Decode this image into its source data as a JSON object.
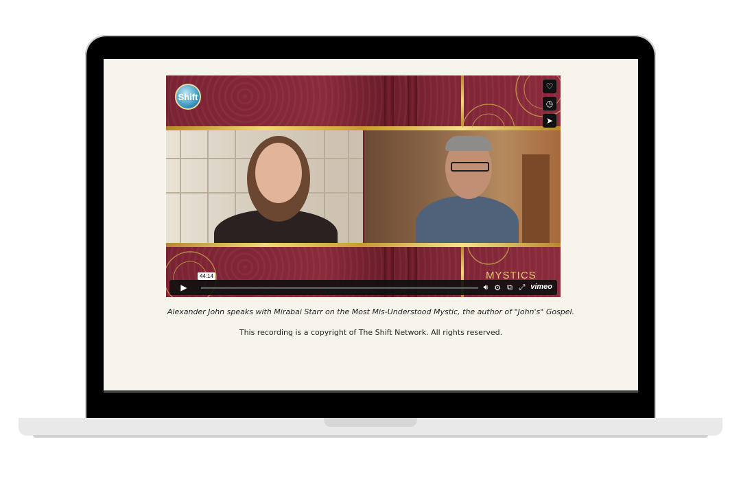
{
  "player": {
    "logo_text": "Shift",
    "banner_text": "MYSTICS",
    "time_tooltip": "44:14",
    "brand": "vimeo",
    "progress": 0.0,
    "icons": {
      "like": "heart-icon",
      "watch_later": "clock-icon",
      "share": "send-icon",
      "play": "play-icon",
      "volume": "volume-icon",
      "settings": "gear-icon",
      "pip": "picture-in-picture-icon",
      "fullscreen": "fullscreen-icon"
    }
  },
  "content": {
    "caption": "Alexander John speaks with Mirabai Starr on the Most Mis-Understood Mystic, the author of \"John's\" Gospel.",
    "copyright": "This recording is a copyright of The Shift Network. All rights reserved."
  },
  "colors": {
    "page_bg": "#f7f4ec",
    "banner": "#7a2233",
    "gold": "#d9b24f"
  }
}
